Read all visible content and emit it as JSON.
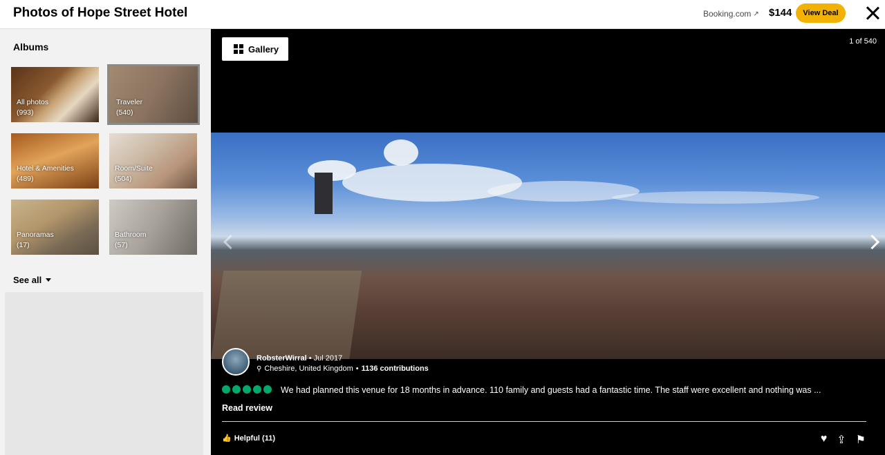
{
  "header": {
    "title": "Photos of Hope Street Hotel",
    "provider": "Booking.com",
    "provider_icon": "external-link-icon",
    "price": "$144",
    "deal_label": "View Deal",
    "close_icon": "close-icon"
  },
  "sidebar": {
    "albums_title": "Albums",
    "albums": [
      {
        "name": "All photos",
        "count": "(993)"
      },
      {
        "name": "Traveler",
        "count": "(540)",
        "selected": true
      },
      {
        "name": "Hotel & Amenities",
        "count": "(489)"
      },
      {
        "name": "Room/Suite",
        "count": "(504)"
      },
      {
        "name": "Panoramas",
        "count": "(17)"
      },
      {
        "name": "Bathroom",
        "count": "(57)"
      }
    ],
    "see_all": "See all"
  },
  "viewer": {
    "gallery_label": "Gallery",
    "counter": "1 of 540",
    "review": {
      "user": "RobsterWirral",
      "date": "Jul 2017",
      "location": "Cheshire, United Kingdom",
      "contributions": "1136 contributions",
      "rating": 5,
      "text": "We had planned this venue for 18 months in advance. 110 family and guests had a fantastic time. The staff were excellent and nothing was ...",
      "read_review": "Read review",
      "helpful": "Helpful (11)"
    }
  },
  "colors": {
    "accent": "#f2b203",
    "rating": "#00aa6c"
  }
}
